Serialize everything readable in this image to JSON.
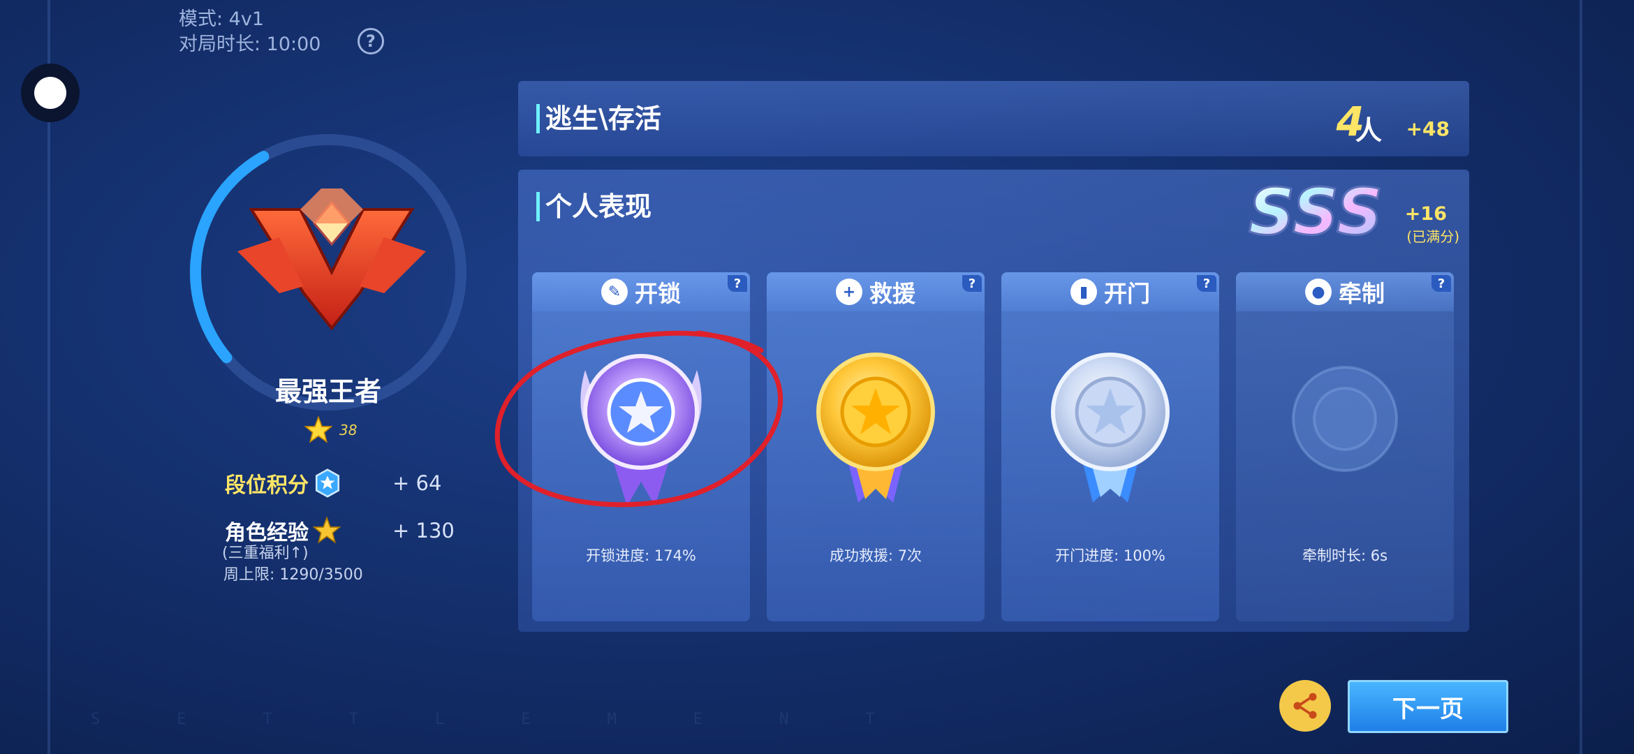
{
  "match_info": {
    "mode": "模式: 4v1",
    "duration": "对局时长: 10:00",
    "help_glyph": "?"
  },
  "rank": {
    "name": "最强王者",
    "stars": "38",
    "points_label": "段位积分",
    "points_value": "+ 64",
    "exp_label": "角色经验",
    "exp_value": "+ 130",
    "exp_note": "(三重福利↑)",
    "weekly_limit": "周上限: 1290/3500",
    "progress_fraction": 0.28
  },
  "escape": {
    "title": "逃生\\存活",
    "count": "4",
    "unit": "人",
    "bonus": "+48"
  },
  "performance": {
    "title": "个人表现",
    "grade": "SSS",
    "bonus": "+16",
    "note": "(已满分)",
    "cards": [
      {
        "title": "开锁",
        "icon": "wrench-icon",
        "stat": "开锁进度: 174%",
        "medal": "diamond"
      },
      {
        "title": "救援",
        "icon": "medkit-icon",
        "stat": "成功救援: 7次",
        "medal": "gold"
      },
      {
        "title": "开门",
        "icon": "door-icon",
        "stat": "开门进度: 100%",
        "medal": "silver"
      },
      {
        "title": "牵制",
        "icon": "person-icon",
        "stat": "牵制时长: 6s",
        "medal": "none"
      }
    ]
  },
  "buttons": {
    "next": "下一页"
  },
  "watermark": "SETTLEMENT",
  "colors": {
    "accent_yellow": "#ffe566",
    "title_bar_cyan": "#6ff0ff",
    "next_button": "#1f7fe8",
    "annotation_red": "#e0202a"
  }
}
